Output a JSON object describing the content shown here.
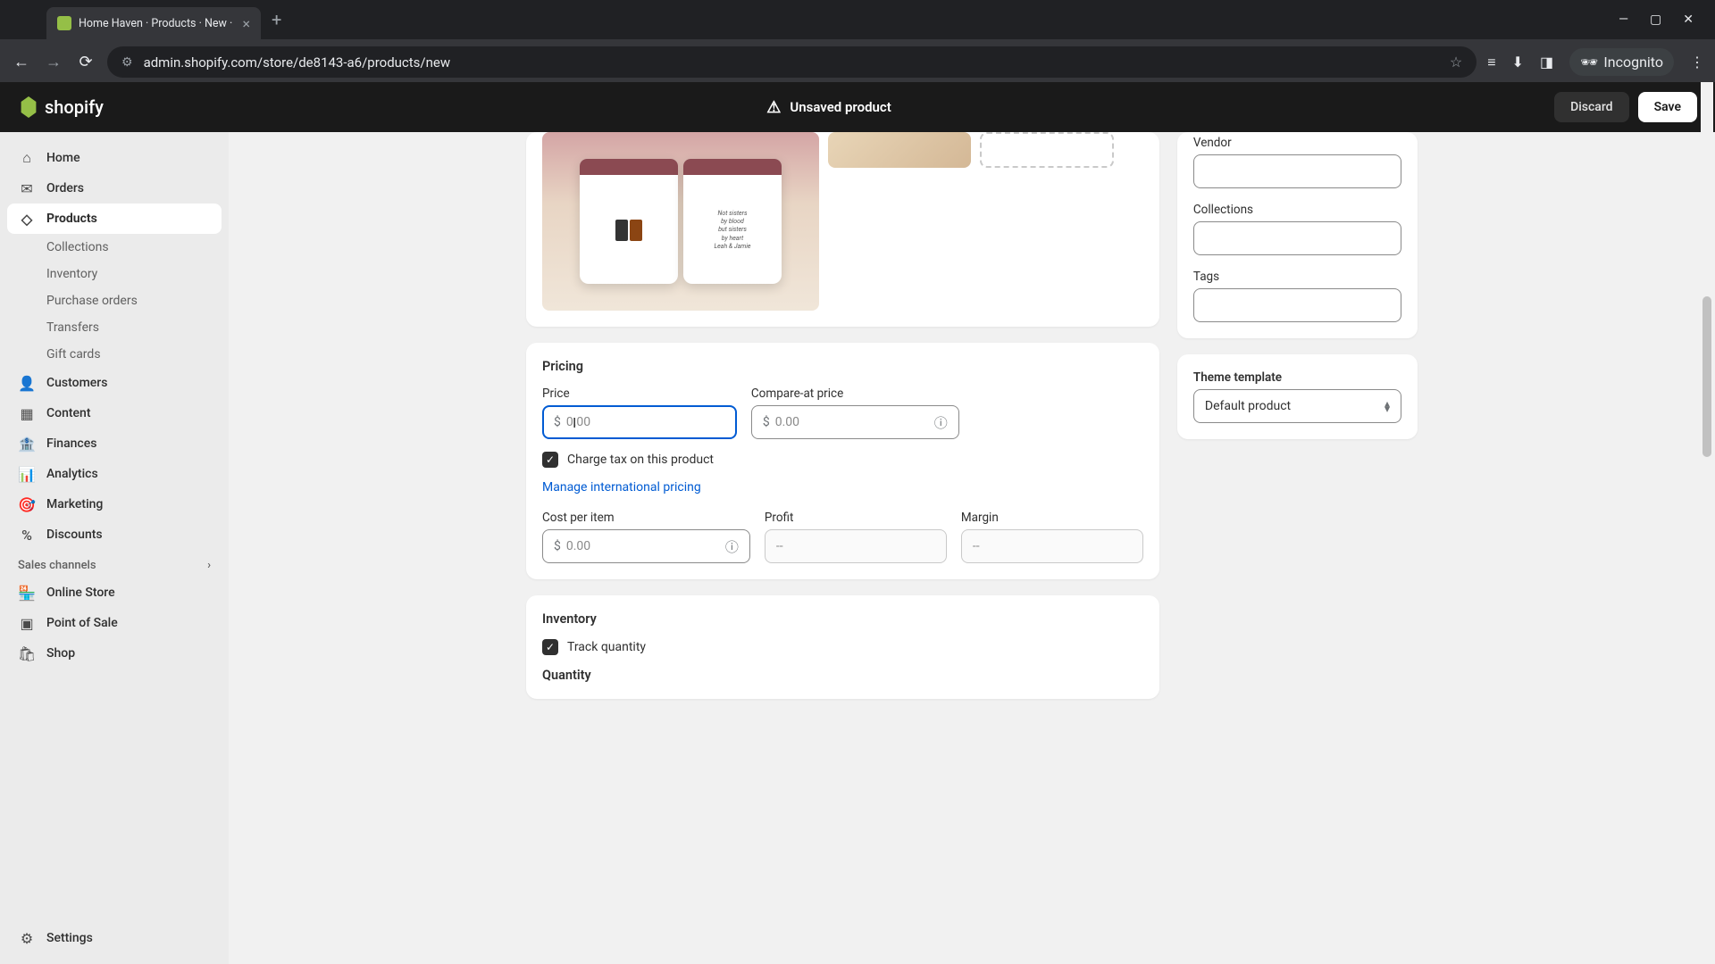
{
  "browser": {
    "tab_title": "Home Haven · Products · New ·",
    "url": "admin.shopify.com/store/de8143-a6/products/new",
    "incognito_label": "Incognito"
  },
  "header": {
    "logo_text": "shopify",
    "status": "Unsaved product",
    "discard": "Discard",
    "save": "Save"
  },
  "sidebar": {
    "home": "Home",
    "orders": "Orders",
    "products": "Products",
    "collections": "Collections",
    "inventory": "Inventory",
    "purchase_orders": "Purchase orders",
    "transfers": "Transfers",
    "gift_cards": "Gift cards",
    "customers": "Customers",
    "content": "Content",
    "finances": "Finances",
    "analytics": "Analytics",
    "marketing": "Marketing",
    "discounts": "Discounts",
    "sales_channels": "Sales channels",
    "online_store": "Online Store",
    "point_of_sale": "Point of Sale",
    "shop": "Shop",
    "settings": "Settings"
  },
  "media": {
    "mug_text_1": "",
    "mug_text_2": "Not sisters\nby blood\nbut sisters\nby heart\nLeah & Jamie"
  },
  "pricing": {
    "title": "Pricing",
    "price_label": "Price",
    "price_value": "",
    "price_placeholder": "0.00",
    "compare_label": "Compare-at price",
    "compare_placeholder": "0.00",
    "currency": "$",
    "charge_tax": "Charge tax on this product",
    "manage_intl": "Manage international pricing",
    "cost_label": "Cost per item",
    "cost_placeholder": "0.00",
    "profit_label": "Profit",
    "profit_placeholder": "--",
    "margin_label": "Margin",
    "margin_placeholder": "--"
  },
  "inventory": {
    "title": "Inventory",
    "track_quantity": "Track quantity",
    "quantity_label": "Quantity"
  },
  "side": {
    "vendor_label": "Vendor",
    "collections_label": "Collections",
    "tags_label": "Tags",
    "theme_label": "Theme template",
    "theme_value": "Default product"
  }
}
